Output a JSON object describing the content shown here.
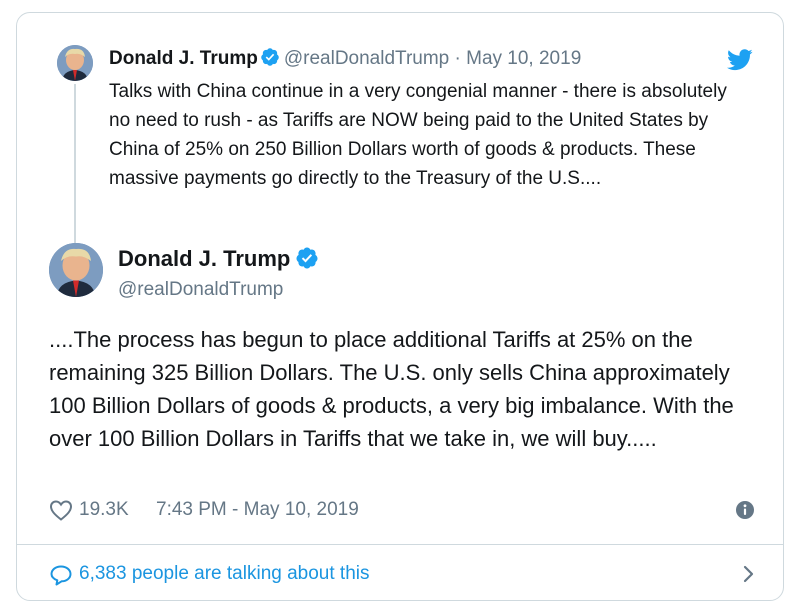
{
  "parent_tweet": {
    "name": "Donald J. Trump",
    "handle": "@realDonaldTrump",
    "separator": " · ",
    "date": "May 10, 2019",
    "text": "Talks with China continue in a very congenial manner - there is absolutely no need to rush - as Tariffs are NOW being paid to the United States by China of 25% on 250 Billion Dollars worth of goods & products. These massive payments go directly to the Treasury of the U.S...."
  },
  "main_tweet": {
    "name": "Donald J. Trump",
    "handle": "@realDonaldTrump",
    "text": "....The process has begun to place additional Tariffs at 25% on the remaining 325 Billion Dollars. The U.S. only sells China approximately 100 Billion Dollars of goods & products, a very big imbalance. With the over 100 Billion Dollars in Tariffs that we take in, we will buy.....",
    "likes": "19.3K",
    "timestamp": "7:43 PM - May 10, 2019"
  },
  "footer": {
    "talking_text": "6,383 people are talking about this"
  },
  "icons": {
    "verified": "verified-badge-icon",
    "bird": "twitter-bird-icon",
    "heart": "heart-icon",
    "info": "info-icon",
    "comment": "comment-bubble-icon",
    "chevron": "chevron-right-icon"
  },
  "colors": {
    "accent": "#1da1f2",
    "link": "#1b95e0",
    "muted": "#657786",
    "border": "#cfd9de",
    "text": "#14171a"
  }
}
